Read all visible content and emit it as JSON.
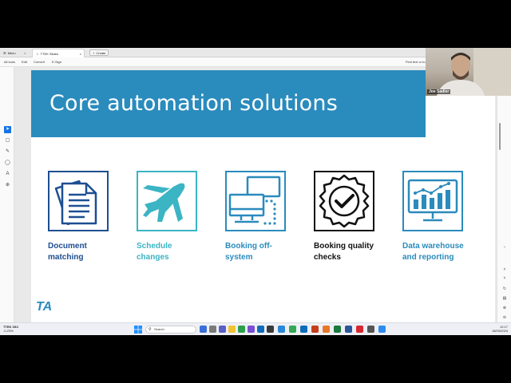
{
  "titlebar": {
    "menu_label": "Menu",
    "tab_label": "TTEK Slides",
    "new_tab_label": "Create"
  },
  "toolbar": {
    "all_tools": "All tools",
    "edit": "Edit",
    "convert": "Convert",
    "esign": "E-Sign",
    "find_text": "Find text or to"
  },
  "slide": {
    "title": "Core automation solutions",
    "logo": "TA",
    "solutions": [
      {
        "label_line1": "Document",
        "label_line2": "matching",
        "color": "#1d4f91",
        "icon": "documents-icon"
      },
      {
        "label_line1": "Schedule",
        "label_line2": "changes",
        "color": "#3bb4c4",
        "icon": "airplane-icon"
      },
      {
        "label_line1": "Booking off-",
        "label_line2": "system",
        "color": "#2a8bbd",
        "icon": "monitors-icon"
      },
      {
        "label_line1": "Booking quality",
        "label_line2": "checks",
        "color": "#111111",
        "icon": "check-badge-icon"
      },
      {
        "label_line1": "Data warehouse",
        "label_line2": "and reporting",
        "color": "#2a8bbd",
        "icon": "dashboard-icon"
      }
    ]
  },
  "webcam": {
    "name": "Joe Sadler"
  },
  "taskbar": {
    "weather_temp": "TTEK 3SC",
    "weather_desc": "-0.23%",
    "search_placeholder": "Search",
    "time": "12:17",
    "date": "18/03/2024"
  },
  "colors": {
    "brand_blue": "#2a8bbd",
    "dark_blue": "#1d4f91",
    "teal": "#3bb4c4"
  }
}
